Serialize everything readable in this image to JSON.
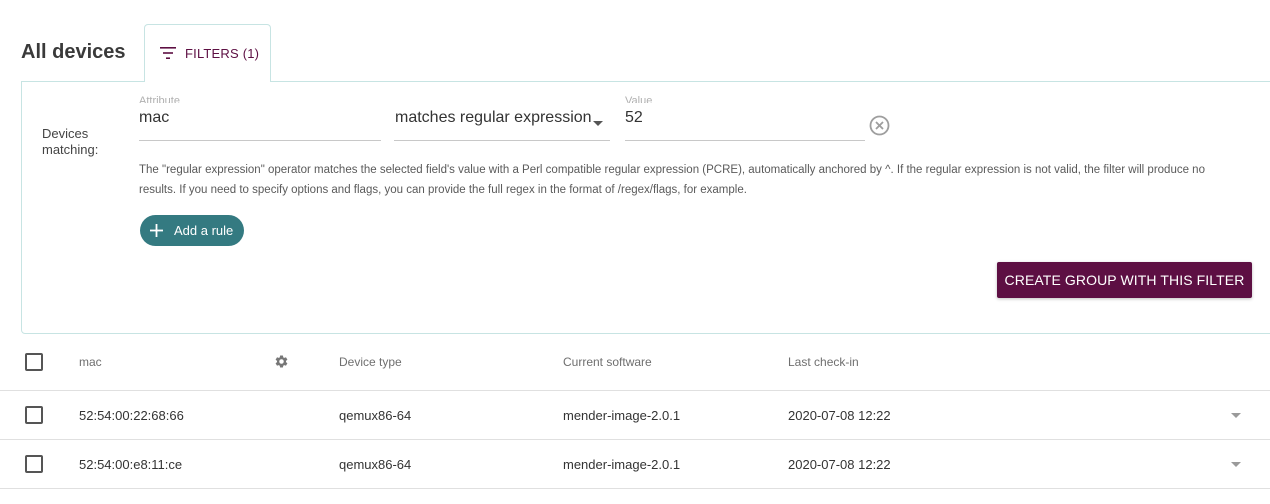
{
  "page": {
    "title": "All devices"
  },
  "filters_tab": {
    "label": "FILTERS (1)",
    "icon": "filter-list-icon"
  },
  "filter": {
    "devices_matching_label": "Devices matching:",
    "attribute_label": "Attribute",
    "attribute_value": "mac",
    "operator_value": "matches regular expression",
    "value_label": "Value",
    "value_value": "52",
    "help_text": "The \"regular expression\" operator matches the selected field's value with a Perl compatible regular expression (PCRE), automatically anchored by ^. If the regular expression is not valid, the filter will produce no results. If you need to specify options and flags, you can provide the full regex in the format of /regex/flags, for example.",
    "add_rule_label": "Add a rule",
    "create_group_label": "CREATE GROUP WITH THIS FILTER"
  },
  "table": {
    "columns": [
      "mac",
      "Device type",
      "Current software",
      "Last check-in"
    ],
    "rows": [
      {
        "mac": "52:54:00:22:68:66",
        "device_type": "qemux86-64",
        "software": "mender-image-2.0.1",
        "last_checkin": "2020-07-08 12:22"
      },
      {
        "mac": "52:54:00:e8:11:ce",
        "device_type": "qemux86-64",
        "software": "mender-image-2.0.1",
        "last_checkin": "2020-07-08 12:22"
      }
    ]
  },
  "colors": {
    "primary": "#5d0f43",
    "secondary": "#347a81",
    "border": "#c7e4e3"
  }
}
